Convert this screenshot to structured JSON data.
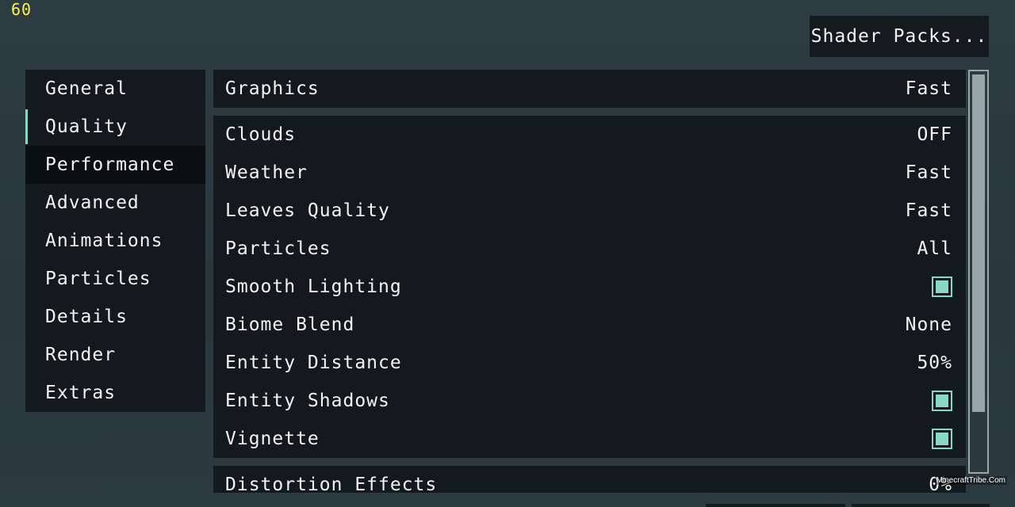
{
  "fps": "60",
  "header": {
    "shader_packs_label": "Shader Packs..."
  },
  "sidebar": {
    "items": [
      {
        "label": "General"
      },
      {
        "label": "Quality",
        "selected": true
      },
      {
        "label": "Performance",
        "hovered": true
      },
      {
        "label": "Advanced"
      },
      {
        "label": "Animations"
      },
      {
        "label": "Particles"
      },
      {
        "label": "Details"
      },
      {
        "label": "Render"
      },
      {
        "label": "Extras"
      }
    ]
  },
  "options": {
    "graphics": {
      "label": "Graphics",
      "value": "Fast"
    },
    "clouds": {
      "label": "Clouds",
      "value": "OFF"
    },
    "weather": {
      "label": "Weather",
      "value": "Fast"
    },
    "leaves_quality": {
      "label": "Leaves Quality",
      "value": "Fast"
    },
    "particles": {
      "label": "Particles",
      "value": "All"
    },
    "smooth_lighting": {
      "label": "Smooth Lighting",
      "checked": true
    },
    "biome_blend": {
      "label": "Biome Blend",
      "value": "None"
    },
    "entity_distance": {
      "label": "Entity Distance",
      "value": "50%"
    },
    "entity_shadows": {
      "label": "Entity Shadows",
      "checked": true
    },
    "vignette": {
      "label": "Vignette",
      "checked": true
    },
    "distortion_effects": {
      "label": "Distortion Effects",
      "value": "0%"
    }
  },
  "watermark": "MinecraftTribe.Com",
  "colors": {
    "accent": "#8ad7c6",
    "background": "#2c3a40",
    "panel": "#121a1e",
    "fps_text": "#f7f34e"
  }
}
